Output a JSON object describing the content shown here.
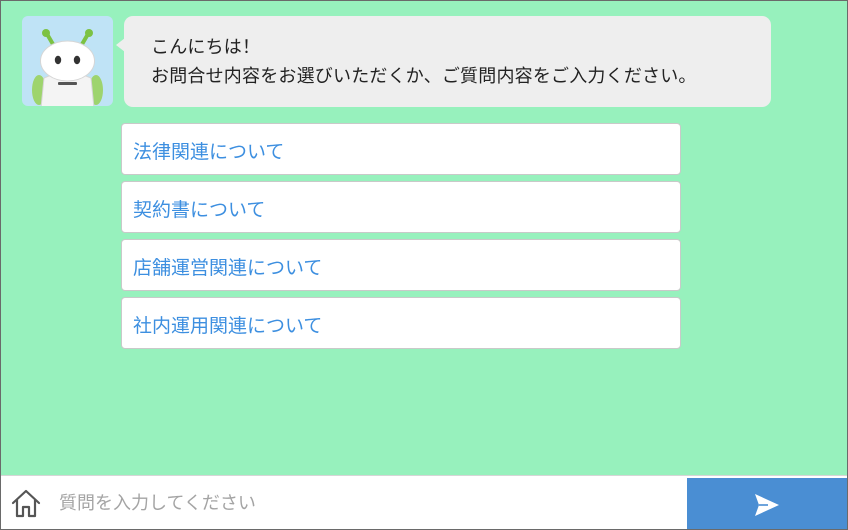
{
  "bot": {
    "avatar_icon": "robot-icon",
    "greeting_line1": "こんにちは！",
    "greeting_line2": "お問合せ内容をお選びいただくか、ご質問内容をご入力ください。"
  },
  "options": [
    {
      "label": "法律関連について"
    },
    {
      "label": "契約書について"
    },
    {
      "label": "店舗運営関連について"
    },
    {
      "label": "社内運用関連について"
    }
  ],
  "footer": {
    "home_icon": "home-icon",
    "input_placeholder": "質問を入力してください",
    "input_value": "",
    "send_icon": "send-icon"
  },
  "colors": {
    "background": "#97f1bd",
    "bubble": "#eeeeee",
    "option_text": "#3d8fe0",
    "send_button": "#4a8ed3",
    "avatar_bg": "#bfe3f6"
  }
}
